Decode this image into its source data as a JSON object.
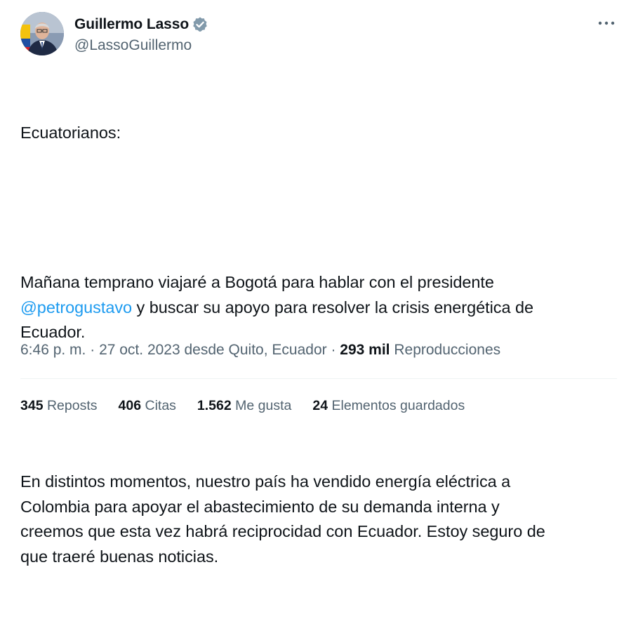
{
  "author": {
    "display_name": "Guillermo Lasso",
    "handle": "@LassoGuillermo",
    "verified": true
  },
  "tweet": {
    "paragraphs": [
      {
        "text": "Ecuatorianos:"
      },
      {
        "before": "Mañana temprano viajaré a Bogotá para hablar con el presidente\n",
        "mention": "@petrogustavo",
        "after": " y buscar su apoyo para resolver la crisis energética de\nEcuador."
      },
      {
        "text": "En distintos momentos, nuestro país ha vendido energía eléctrica a\nColombia para apoyar el abastecimiento de su demanda interna y\ncreemos que esta vez habrá reciprocidad con Ecuador. Estoy seguro de\nque traeré buenas noticias."
      }
    ]
  },
  "meta": {
    "time": "6:46 p. m.",
    "separator": " · ",
    "date_location": "27 oct. 2023 desde Quito, Ecuador",
    "views_count": "293 mil",
    "views_label": "Reproducciones"
  },
  "stats": [
    {
      "count": "345",
      "label": "Reposts"
    },
    {
      "count": "406",
      "label": "Citas"
    },
    {
      "count": "1.562",
      "label": "Me gusta"
    },
    {
      "count": "24",
      "label": "Elementos guardados"
    }
  ],
  "colors": {
    "text": "#0f1419",
    "secondary": "#536471",
    "accent": "#1d9bf0",
    "divider": "#eff3f4"
  },
  "icons": {
    "verified": "verified-badge-icon",
    "more": "more-options-icon"
  }
}
